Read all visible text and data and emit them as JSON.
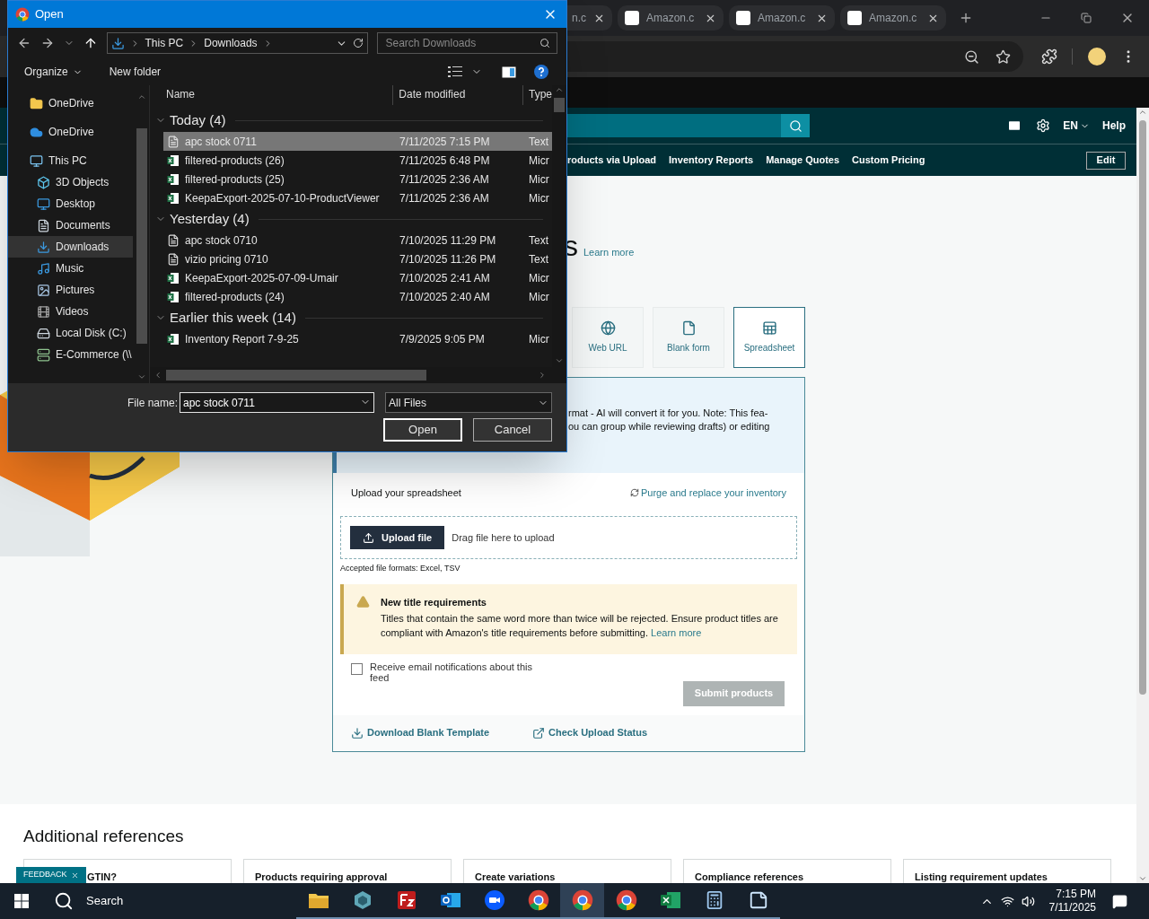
{
  "browser": {
    "tabs": [
      {
        "title": "n.c",
        "selected": false
      },
      {
        "title": "Amazon.c",
        "selected": false
      },
      {
        "title": "Amazon.c",
        "selected": false
      },
      {
        "title": "Amazon.c",
        "selected": false
      }
    ],
    "language": "EN",
    "help": "Help",
    "nav": [
      "roducts via Upload",
      "Inventory Reports",
      "Manage Quotes",
      "Custom Pricing"
    ],
    "edit_button": "Edit"
  },
  "page": {
    "heading": "s",
    "heading_link": "Learn more",
    "methods": [
      {
        "label": "Web URL",
        "kind": "globe",
        "selected": false
      },
      {
        "label": "Blank form",
        "kind": "file",
        "selected": false
      },
      {
        "label": "Spreadsheet",
        "kind": "grid",
        "selected": true
      }
    ],
    "info_lines": [
      "rmat - AI will convert it for you. Note: This fea-",
      "ou can group while reviewing drafts) or editing"
    ],
    "upload_title": "Upload your spreadsheet",
    "purge_link": "Purge and replace your inventory",
    "upload_button": "Upload file",
    "drop_hint": "Drag file here to upload",
    "accepted_formats": "Accepted file formats: Excel, TSV",
    "notice": {
      "title": "New title requirements",
      "body": "Titles that contain the same word more than twice will be rejected. Ensure product titles are compliant with Amazon's title requirements before submitting.",
      "link": "Learn more"
    },
    "email_checkbox": {
      "label": "Receive email notifications about this feed",
      "checked": false
    },
    "submit_button": {
      "label": "Submit products",
      "disabled": true
    },
    "footer_links": [
      {
        "label": "Download Blank Template",
        "kind": "download"
      },
      {
        "label": "Check Upload Status",
        "kind": "external"
      }
    ],
    "references": {
      "title": "Additional references",
      "cards": [
        "GTIN?",
        "Products requiring approval",
        "Create variations",
        "Compliance references",
        "Listing requirement updates"
      ]
    },
    "feedback": "FEEDBACK"
  },
  "dialog": {
    "title": "Open",
    "breadcrumb": [
      "This PC",
      "Downloads"
    ],
    "search_placeholder": "Search Downloads",
    "organize": "Organize",
    "new_folder": "New folder",
    "nav": [
      {
        "label": "OneDrive",
        "kind": "folder",
        "selected": false
      },
      {
        "label": "OneDrive",
        "kind": "cloud",
        "selected": false
      },
      {
        "label": "This PC",
        "kind": "pc",
        "selected": false,
        "children": [
          {
            "label": "3D Objects",
            "kind": "cube",
            "selected": false
          },
          {
            "label": "Desktop",
            "kind": "desktop",
            "selected": false
          },
          {
            "label": "Documents",
            "kind": "documents",
            "selected": false
          },
          {
            "label": "Downloads",
            "kind": "downloads",
            "selected": true
          },
          {
            "label": "Music",
            "kind": "music",
            "selected": false
          },
          {
            "label": "Pictures",
            "kind": "pictures",
            "selected": false
          },
          {
            "label": "Videos",
            "kind": "videos",
            "selected": false
          },
          {
            "label": "Local Disk (C:)",
            "kind": "disk",
            "selected": false
          },
          {
            "label": "E-Commerce (\\\\",
            "kind": "netdrive",
            "selected": false
          }
        ]
      }
    ],
    "columns": [
      "Name",
      "Date modified",
      "Type"
    ],
    "groups": [
      {
        "label": "Today (4)",
        "expanded": true,
        "files": [
          {
            "name": "apc stock 0711",
            "date": "7/11/2025 7:15 PM",
            "type": "Text",
            "kind": "text",
            "selected": true
          },
          {
            "name": "filtered-products (26)",
            "date": "7/11/2025 6:48 PM",
            "type": "Micr",
            "kind": "excel",
            "selected": false
          },
          {
            "name": "filtered-products (25)",
            "date": "7/11/2025 2:36 AM",
            "type": "Micr",
            "kind": "excel",
            "selected": false
          },
          {
            "name": "KeepaExport-2025-07-10-ProductViewer",
            "date": "7/11/2025 2:36 AM",
            "type": "Micr",
            "kind": "excel",
            "selected": false
          }
        ]
      },
      {
        "label": "Yesterday (4)",
        "expanded": true,
        "files": [
          {
            "name": "apc stock 0710",
            "date": "7/10/2025 11:29 PM",
            "type": "Text",
            "kind": "text",
            "selected": false
          },
          {
            "name": "vizio pricing 0710",
            "date": "7/10/2025 11:26 PM",
            "type": "Text",
            "kind": "text",
            "selected": false
          },
          {
            "name": "KeepaExport-2025-07-09-Umair",
            "date": "7/10/2025 2:41 AM",
            "type": "Micr",
            "kind": "excel",
            "selected": false
          },
          {
            "name": "filtered-products (24)",
            "date": "7/10/2025 2:40 AM",
            "type": "Micr",
            "kind": "excel",
            "selected": false
          }
        ]
      },
      {
        "label": "Earlier this week (14)",
        "expanded": true,
        "files": [
          {
            "name": "Inventory Report 7-9-25",
            "date": "7/9/2025 9:05 PM",
            "type": "Micr",
            "kind": "excel",
            "selected": false
          }
        ]
      }
    ],
    "file_name_label": "File name:",
    "file_name": "apc stock 0711",
    "filter": "All Files",
    "open_button": "Open",
    "cancel_button": "Cancel"
  },
  "taskbar": {
    "search": "Search",
    "apps": [
      {
        "kind": "folder",
        "selected": false
      },
      {
        "kind": "cube",
        "selected": false
      },
      {
        "kind": "ftp",
        "selected": false
      },
      {
        "kind": "mail",
        "selected": false
      },
      {
        "kind": "video",
        "selected": false
      },
      {
        "kind": "browser",
        "selected": false
      },
      {
        "kind": "browser",
        "selected": true
      },
      {
        "kind": "browser",
        "selected": false
      },
      {
        "kind": "sheet",
        "selected": false
      },
      {
        "kind": "calc",
        "selected": false
      },
      {
        "kind": "note",
        "selected": false
      }
    ],
    "time": "7:15 PM",
    "date": "7/11/2025"
  }
}
